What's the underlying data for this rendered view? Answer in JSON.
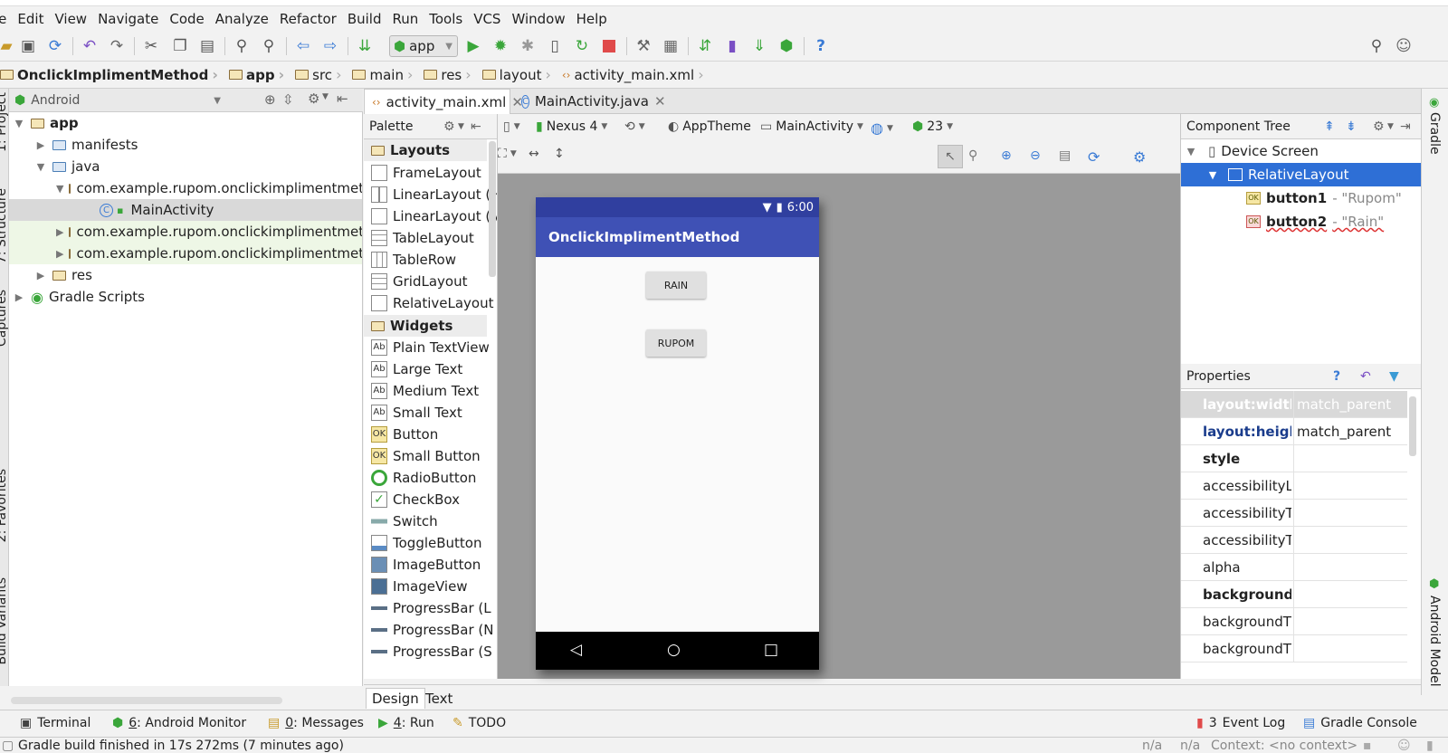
{
  "menu": [
    "le",
    "Edit",
    "View",
    "Navigate",
    "Code",
    "Analyze",
    "Refactor",
    "Build",
    "Run",
    "Tools",
    "VCS",
    "Window",
    "Help"
  ],
  "toolbar": {
    "run_config": "app",
    "help_glyph": "?"
  },
  "breadcrumb": [
    {
      "label": "OnclickImplimentMethod",
      "bold": true
    },
    {
      "label": "app",
      "bold": true
    },
    {
      "label": "src"
    },
    {
      "label": "main"
    },
    {
      "label": "res"
    },
    {
      "label": "layout"
    },
    {
      "label": "activity_main.xml"
    }
  ],
  "project": {
    "view": "Android",
    "tree": [
      "app",
      "manifests",
      "java",
      "com.example.rupom.onclickimplimentmeth",
      "MainActivity",
      "com.example.rupom.onclickimplimentmeth",
      "com.example.rupom.onclickimplimentmeth",
      "res",
      "Gradle Scripts"
    ]
  },
  "side_tabs": {
    "left": [
      "1: Project",
      "7: Structure",
      "Captures",
      "2: Favorites",
      "Build Variants"
    ],
    "right": [
      "Gradle",
      "Android Model"
    ]
  },
  "editor_tabs": [
    "activity_main.xml",
    "MainActivity.java"
  ],
  "palette": {
    "title": "Palette",
    "groups": [
      "Layouts",
      "Widgets"
    ],
    "layouts": [
      "FrameLayout",
      "LinearLayout (H",
      "LinearLayout (V",
      "TableLayout",
      "TableRow",
      "GridLayout",
      "RelativeLayout"
    ],
    "widgets": [
      "Plain TextView",
      "Large Text",
      "Medium Text",
      "Small Text",
      "Button",
      "Small Button",
      "RadioButton",
      "CheckBox",
      "Switch",
      "ToggleButton",
      "ImageButton",
      "ImageView",
      "ProgressBar (L",
      "ProgressBar (N",
      "ProgressBar (S"
    ]
  },
  "design_toolbar": {
    "device": "Nexus 4",
    "theme": "AppTheme",
    "activity": "MainActivity",
    "api": "23"
  },
  "preview": {
    "time": "6:00",
    "app_title": "OnclickImplimentMethod",
    "button_top": "RAIN",
    "button_bottom": "RUPOM"
  },
  "design_tabs": [
    "Design",
    "Text"
  ],
  "component_tree": {
    "title": "Component Tree",
    "root": "Device Screen",
    "layout": "RelativeLayout",
    "children": [
      {
        "id": "button1",
        "text": "- \"Rupom\""
      },
      {
        "id": "button2",
        "text": "- \"Rain\""
      }
    ]
  },
  "properties": {
    "title": "Properties",
    "rows": [
      {
        "key": "layout:width",
        "value": "match_parent"
      },
      {
        "key": "layout:height",
        "value": "match_parent"
      },
      {
        "key": "style",
        "value": ""
      },
      {
        "key": "accessibilityLive",
        "value": ""
      },
      {
        "key": "accessibilityTrav",
        "value": ""
      },
      {
        "key": "accessibilityTrav",
        "value": ""
      },
      {
        "key": "alpha",
        "value": ""
      },
      {
        "key": "background",
        "value": ""
      },
      {
        "key": "backgroundTin",
        "value": ""
      },
      {
        "key": "backgroundTin",
        "value": ""
      }
    ]
  },
  "bottom_tools": [
    {
      "key": "",
      "label": "Terminal"
    },
    {
      "key": "6",
      "label": ": Android Monitor"
    },
    {
      "key": "0",
      "label": ": Messages"
    },
    {
      "key": "4",
      "label": ": Run"
    },
    {
      "key": "",
      "label": "TODO"
    }
  ],
  "right_tools": {
    "event_count": "3",
    "event_log": "Event Log",
    "gradle_console": "Gradle Console"
  },
  "status": {
    "message": "Gradle build finished in 17s 272ms (7 minutes ago)",
    "na1": "n/a",
    "na2": "n/a",
    "context": "Context: <no context>"
  },
  "colors": {
    "accent": "#3f51b5",
    "status_bar": "#303f9f",
    "selection": "#2e6fd6",
    "run_green": "#3aa63a",
    "stop_red": "#e04a4a"
  }
}
